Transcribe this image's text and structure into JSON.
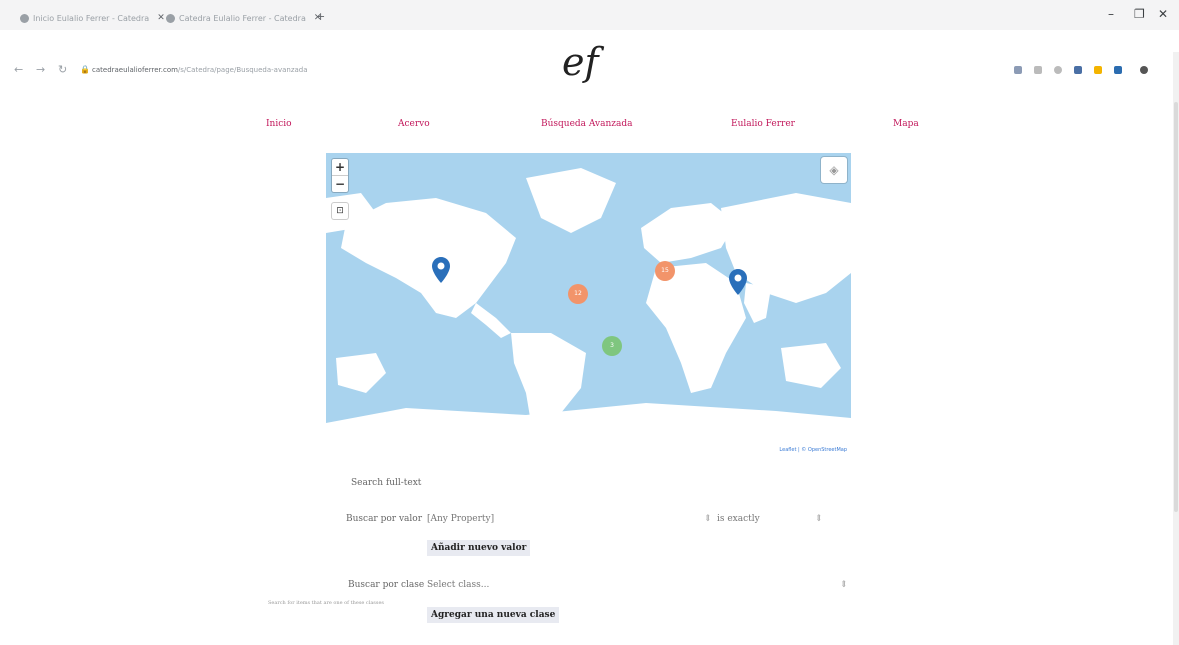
{
  "browser": {
    "tabs": [
      {
        "title": "Inicio Eulalio Ferrer - Catedra"
      },
      {
        "title": "Catedra Eulalio Ferrer - Catedra"
      }
    ],
    "new_tab": "+",
    "url_domain": "catedraeulalioferrer.com",
    "url_path": "/s/Catedra/page/Busqueda-avanzada",
    "window_controls": [
      "–",
      "❐",
      "✕"
    ]
  },
  "site": {
    "logo": "ef",
    "nav": [
      "Inicio",
      "Acervo",
      "Búsqueda Avanzada",
      "Eulalio Ferrer",
      "Mapa"
    ]
  },
  "map": {
    "zoom_in": "+",
    "zoom_out": "−",
    "attribution": "Leaflet | © OpenStreetMap",
    "clusters": [
      {
        "label": "15",
        "color": "#f2946a"
      },
      {
        "label": "12",
        "color": "#f2946a"
      },
      {
        "label": "3",
        "color": "#7fc67f"
      }
    ]
  },
  "form": {
    "search_full_text_label": "Search full-text",
    "search_by_value_label": "Buscar por valor",
    "property_placeholder": "[Any Property]",
    "operator": "is exactly",
    "add_value_button": "Añadir nuevo valor",
    "search_by_class_label": "Buscar por clase",
    "class_placeholder": "Select class...",
    "class_hint": "Search for items that are one of these classes",
    "add_class_button": "Agregar una nueva clase"
  }
}
